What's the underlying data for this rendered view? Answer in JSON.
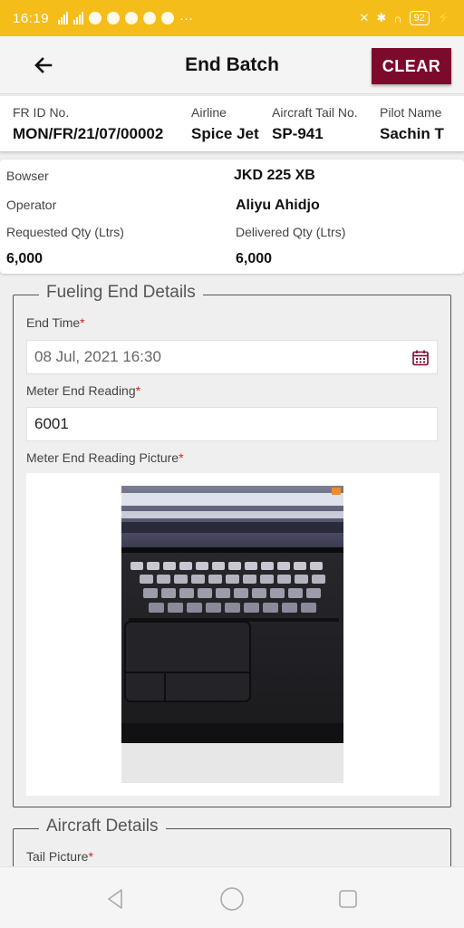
{
  "status_bar": {
    "time": "16:19",
    "battery": "92"
  },
  "app_bar": {
    "title": "End Batch",
    "clear_label": "CLEAR"
  },
  "fr_info": {
    "fr_id_label": "FR ID No.",
    "fr_id_value": "MON/FR/21/07/00002",
    "airline_label": "Airline",
    "airline_value": "Spice Jet",
    "tail_label": "Aircraft Tail No.",
    "tail_value": "SP-941",
    "pilot_label": "Pilot Name",
    "pilot_value": "Sachin T"
  },
  "bowser_card": {
    "bowser_label": "Bowser",
    "bowser_value": "JKD 225 XB",
    "operator_label": "Operator",
    "operator_value": "Aliyu Ahidjo",
    "requested_label": "Requested Qty (Ltrs)",
    "requested_value": "6,000",
    "delivered_label": "Delivered Qty (Ltrs)",
    "delivered_value": "6,000"
  },
  "fueling_end": {
    "legend": "Fueling End Details",
    "end_time_label": "End Time",
    "end_time_value": "08 Jul, 2021 16:30",
    "meter_reading_label": "Meter End Reading",
    "meter_reading_value": "6001",
    "meter_picture_label": "Meter End Reading Picture",
    "required_mark": "*"
  },
  "aircraft_details": {
    "legend": "Aircraft Details",
    "tail_picture_label": "Tail Picture",
    "required_mark": "*"
  },
  "colors": {
    "status_bar": "#f4bd1a",
    "clear_button": "#7c0a2c",
    "required": "#e02020",
    "calendar_icon": "#7c0a2c"
  },
  "icons": {
    "back": "arrow-left-icon",
    "calendar": "calendar-icon",
    "nav_back": "triangle-back-icon",
    "nav_home": "circle-home-icon",
    "nav_recents": "square-recents-icon"
  }
}
